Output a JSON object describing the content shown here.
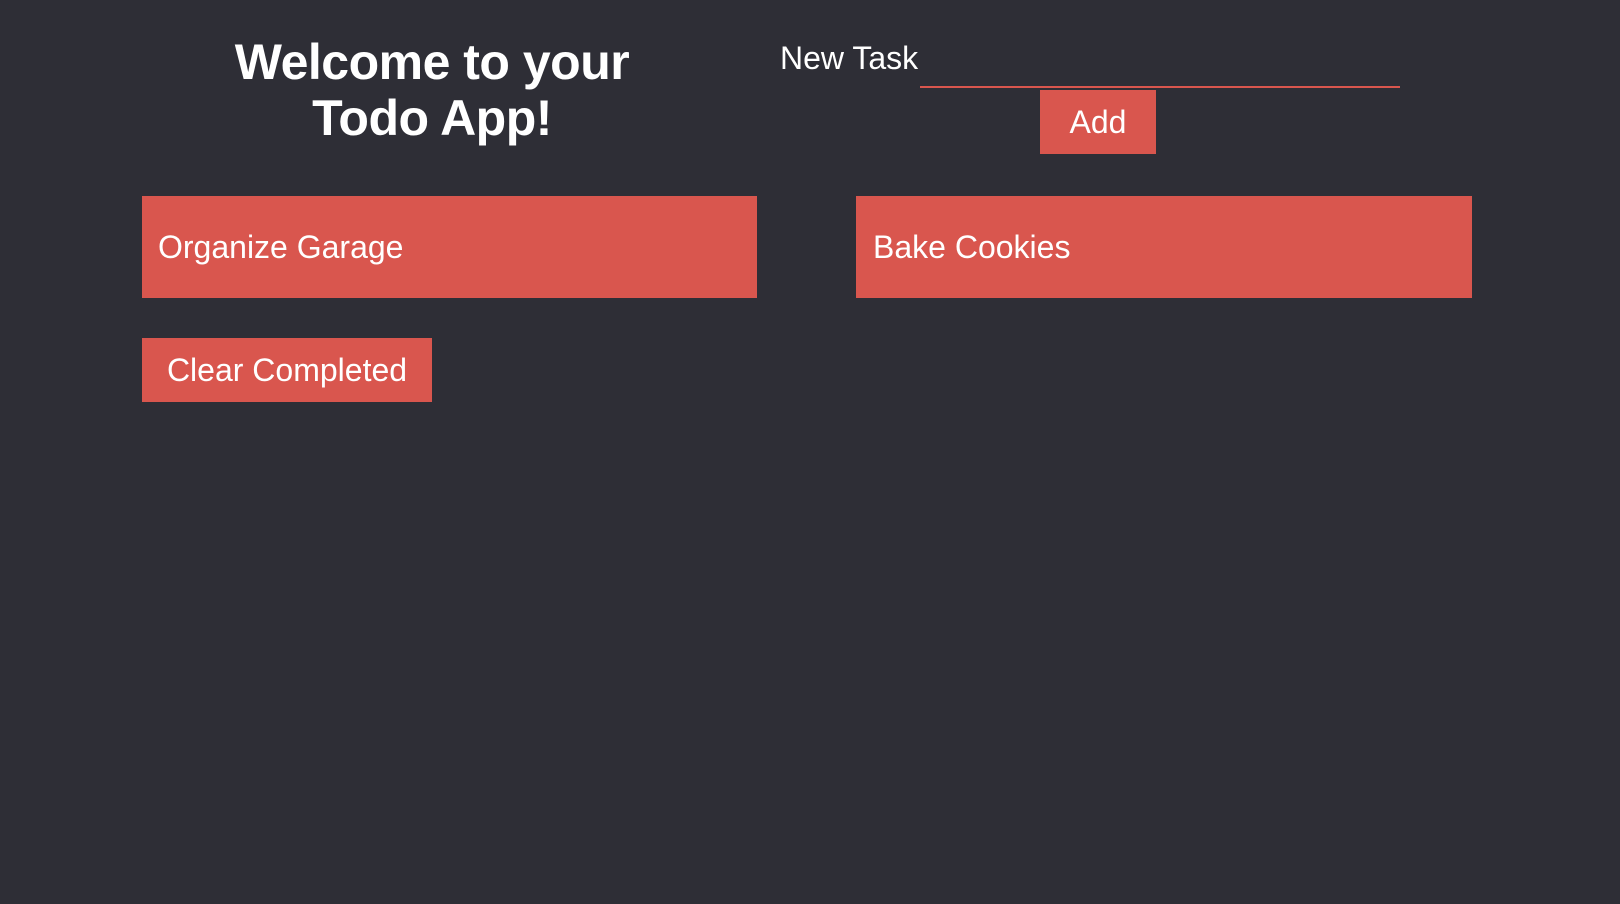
{
  "header": {
    "title": "Welcome to your Todo App!"
  },
  "new_task": {
    "label": "New Task",
    "value": "",
    "placeholder": "",
    "add_label": "Add"
  },
  "todos": [
    {
      "text": "Organize Garage"
    },
    {
      "text": "Bake Cookies"
    }
  ],
  "actions": {
    "clear_completed_label": "Clear Completed"
  },
  "colors": {
    "background": "#2e2e36",
    "accent": "#d9564e",
    "text": "#ffffff"
  }
}
